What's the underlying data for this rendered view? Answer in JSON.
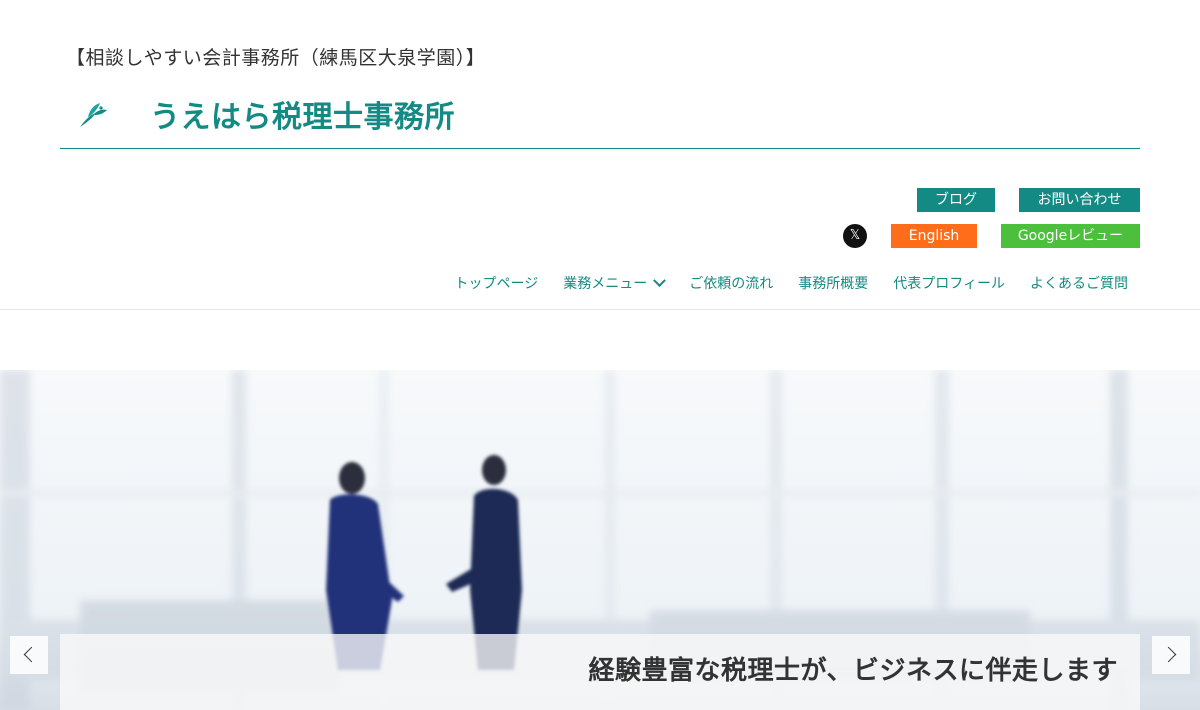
{
  "header": {
    "tagline": "【相談しやすい会計事務所（練馬区大泉学園）】",
    "site_name": "うえはら税理士事務所",
    "logo_icon": "bird-logo-icon"
  },
  "utility_links": {
    "blog": "ブログ",
    "contact": "お問い合わせ",
    "x_icon": "x-social-icon",
    "english": "English",
    "google_review": "Googleレビュー"
  },
  "nav": {
    "items": [
      {
        "label": "トップページ"
      },
      {
        "label": "業務メニュー"
      },
      {
        "label": "ご依頼の流れ"
      },
      {
        "label": "事務所概要"
      },
      {
        "label": "代表プロフィール"
      },
      {
        "label": "よくあるご質問"
      }
    ]
  },
  "hero": {
    "caption": "経験豊富な税理士が、ビジネスに伴走します"
  },
  "colors": {
    "brand": "#138a83",
    "english_button": "#ff6d1a",
    "google_button": "#4cc03c"
  }
}
